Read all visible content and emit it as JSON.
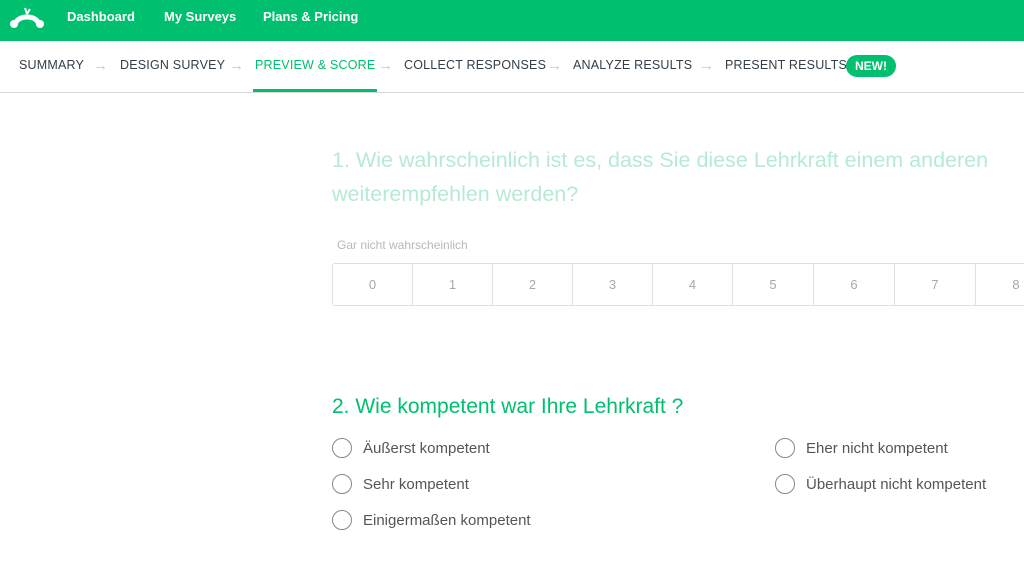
{
  "topbar": {
    "brand_color": "#00bf6f",
    "logo_icon": "monkey-logo-icon",
    "nav": [
      "Dashboard",
      "My Surveys",
      "Plans & Pricing"
    ]
  },
  "steps": [
    {
      "label": "SUMMARY",
      "active": false
    },
    {
      "label": "DESIGN SURVEY",
      "active": false
    },
    {
      "label": "PREVIEW & SCORE",
      "active": true
    },
    {
      "label": "COLLECT RESPONSES",
      "active": false
    },
    {
      "label": "ANALYZE RESULTS",
      "active": false
    },
    {
      "label": "PRESENT RESULTS",
      "active": false
    }
  ],
  "new_badge": "NEW!",
  "question1": {
    "line1": "1. Wie wahrscheinlich ist es, dass Sie diese Lehrkraft einem anderen",
    "line2": "weiterempfehlen werden?",
    "low_label": "Gar nicht wahrscheinlich",
    "scale": [
      "0",
      "1",
      "2",
      "3",
      "4",
      "5",
      "6",
      "7",
      "8"
    ]
  },
  "question2": {
    "title": "2. Wie kompetent war Ihre Lehrkraft ?",
    "options": [
      "Äußerst kompetent",
      "Sehr kompetent",
      "Einigermaßen kompetent",
      "Eher nicht kompetent",
      "Überhaupt nicht kompetent"
    ]
  }
}
